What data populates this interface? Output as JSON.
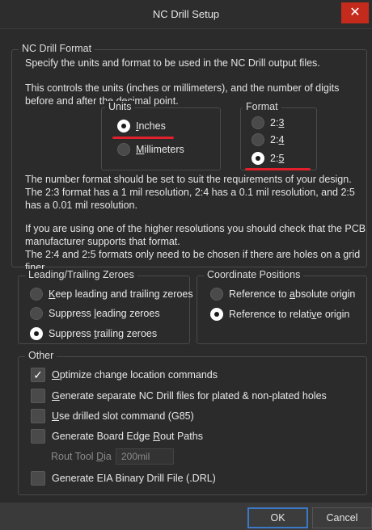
{
  "window": {
    "title": "NC Drill Setup",
    "close_glyph": "✕"
  },
  "format_group": {
    "legend": "NC Drill Format",
    "line1": "Specify the units and format to be used in the NC Drill output files.",
    "line2": "This controls the units (inches or millimeters), and the number of digits before and after the decimal point."
  },
  "units": {
    "legend": "Units",
    "inches_pre": "",
    "inches_u": "I",
    "inches_post": "nches",
    "mm_pre": "",
    "mm_u": "M",
    "mm_post": "illimeters",
    "selected": "Inches"
  },
  "format": {
    "legend": "Format",
    "opt1_pre": "2:",
    "opt1_u": "3",
    "opt2_pre": "2:",
    "opt2_u": "4",
    "opt3_pre": "2:",
    "opt3_u": "5",
    "selected": "2:5"
  },
  "notes": {
    "n1": "The number format should be set to suit the requirements of your design. The 2:3 format has a 1 mil resolution, 2:4 has a 0.1 mil resolution, and 2:5 has a 0.01 mil resolution.",
    "n2": "If you are using one of the higher resolutions you should check that the PCB manufacturer supports that format.",
    "n3": "The 2:4 and 2:5 formats only need to be chosen if there are holes on a grid finer"
  },
  "zeroes": {
    "legend": "Leading/Trailing Zeroes",
    "keep_u": "K",
    "keep_post": "eep leading and trailing zeroes",
    "lead_pre": "Suppress ",
    "lead_u": "l",
    "lead_post": "eading zeroes",
    "trail_pre": "Suppress ",
    "trail_u": "t",
    "trail_post": "railing zeroes",
    "selected": "Suppress trailing zeroes"
  },
  "coords": {
    "legend": "Coordinate Positions",
    "abs_pre": "Reference to ",
    "abs_u": "a",
    "abs_post": "bsolute origin",
    "rel_pre": "Reference to relati",
    "rel_u": "v",
    "rel_post": "e origin",
    "selected": "Reference to relative origin"
  },
  "other": {
    "legend": "Other",
    "opt_u": "O",
    "opt_post": "ptimize change location commands",
    "opt_checked": true,
    "sep_u": "G",
    "sep_post": "enerate separate NC Drill files for plated & non-plated holes",
    "slot_u": "U",
    "slot_post": "se drilled slot command (G85)",
    "edge_pre": "Generate Board Edge ",
    "edge_u": "R",
    "edge_post": "out Paths",
    "tool_pre": "Rout Tool ",
    "tool_u": "D",
    "tool_post": "ia",
    "tool_value": "200mil",
    "eia": "Generate EIA Binary Drill File (.DRL)",
    "check_glyph": "✓"
  },
  "buttons": {
    "ok": "OK",
    "cancel": "Cancel"
  },
  "colors": {
    "accent_red": "#e0202a",
    "focus_blue": "#3b79c6",
    "close_red": "#c42b1c"
  }
}
